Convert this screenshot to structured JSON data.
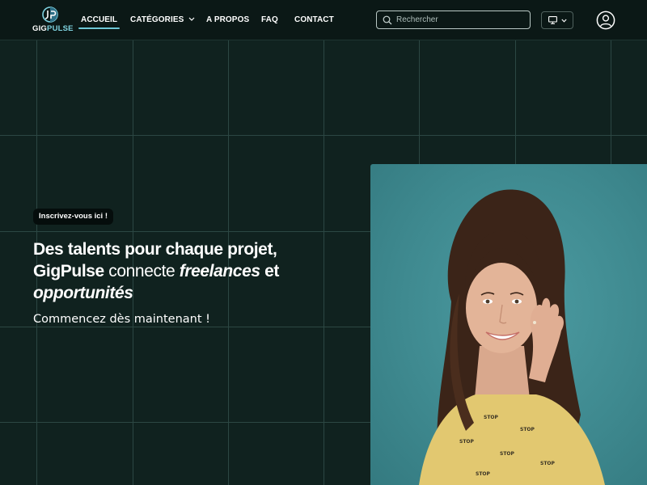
{
  "brand": {
    "name_part1": "GIG",
    "name_part2": "PULSE"
  },
  "nav": {
    "items": [
      {
        "label": "ACCUEIL",
        "active": true
      },
      {
        "label": "CATÉGORIES",
        "has_dropdown": true
      },
      {
        "label": "A PROPOS"
      },
      {
        "label": "FAQ"
      },
      {
        "label": "CONTACT"
      }
    ]
  },
  "search": {
    "placeholder": "Rechercher",
    "value": ""
  },
  "header_icons": {
    "device": "monitor-icon",
    "device_menu": "chevron-down-icon",
    "account": "user-circle-icon"
  },
  "hero": {
    "badge": "Inscrivez-vous ici !",
    "headline_line1": "Des talents pour chaque projet,",
    "headline_brand": "GigPulse",
    "headline_connect": "connecte",
    "headline_freelances": "freelances",
    "headline_et": "et",
    "headline_opportunites": "opportunités",
    "subline": "Commencez dès maintenant !"
  },
  "colors": {
    "background": "#10221f",
    "header": "#0b1816",
    "grid": "#2c4743",
    "accent": "#6ec8d6",
    "photo_backdrop": "#4c9ba1"
  }
}
